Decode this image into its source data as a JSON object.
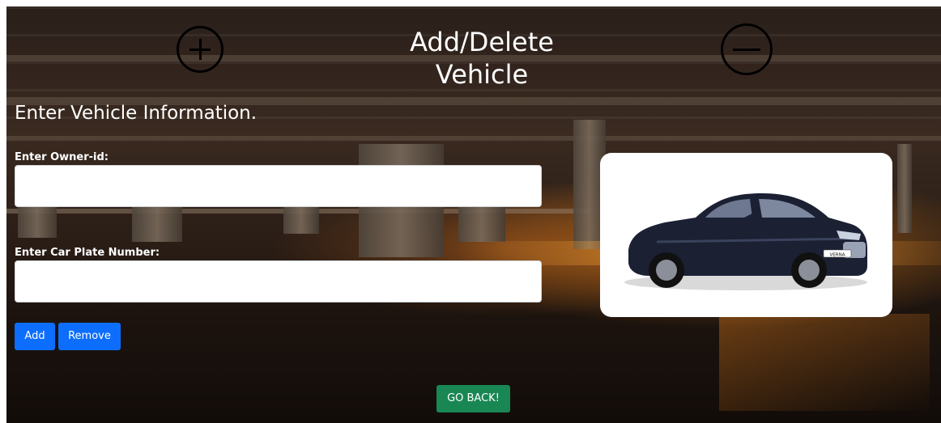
{
  "page": {
    "title_line1": "Add/Delete",
    "title_line2": "Vehicle",
    "subtitle": "Enter Vehicle Information."
  },
  "form": {
    "owner_label": "Enter Owner-id:",
    "owner_value": "",
    "plate_label": "Enter Car Plate Number:",
    "plate_value": "",
    "add_label": "Add",
    "remove_label": "Remove",
    "back_label": "GO BACK!"
  },
  "car_image": {
    "badge_text": "VERNA"
  },
  "icons": {
    "add": "plus-circle-icon",
    "delete": "minus-circle-icon"
  },
  "colors": {
    "primary": "#0d6efd",
    "success": "#198754",
    "car_body": "#1b2033"
  }
}
